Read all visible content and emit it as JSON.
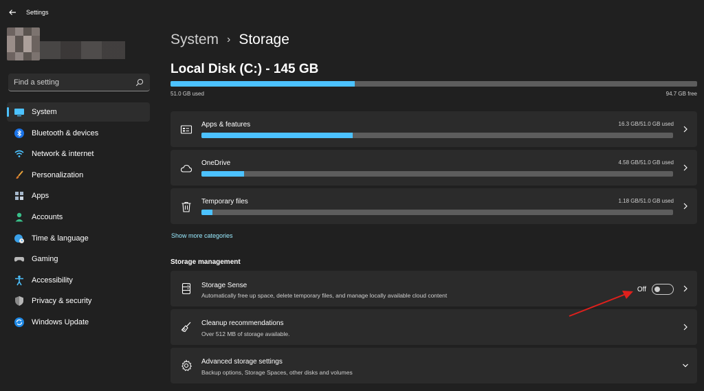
{
  "window": {
    "title": "Settings"
  },
  "search": {
    "placeholder": "Find a setting"
  },
  "sidebar": {
    "items": [
      {
        "label": "System",
        "icon": "monitor-icon",
        "selected": true
      },
      {
        "label": "Bluetooth & devices",
        "icon": "bluetooth-icon"
      },
      {
        "label": "Network & internet",
        "icon": "wifi-icon"
      },
      {
        "label": "Personalization",
        "icon": "brush-icon"
      },
      {
        "label": "Apps",
        "icon": "apps-icon"
      },
      {
        "label": "Accounts",
        "icon": "person-icon"
      },
      {
        "label": "Time & language",
        "icon": "globe-clock-icon"
      },
      {
        "label": "Gaming",
        "icon": "gamepad-icon"
      },
      {
        "label": "Accessibility",
        "icon": "accessibility-icon"
      },
      {
        "label": "Privacy & security",
        "icon": "shield-icon"
      },
      {
        "label": "Windows Update",
        "icon": "update-icon"
      }
    ]
  },
  "breadcrumb": {
    "parent": "System",
    "separator": "›",
    "current": "Storage"
  },
  "disk": {
    "title": "Local Disk (C:) - 145 GB",
    "used_label": "51.0 GB used",
    "free_label": "94.7 GB free",
    "used_fraction": 0.35
  },
  "categories": [
    {
      "label": "Apps & features",
      "size": "16.3 GB/51.0 GB used",
      "fraction": 0.32,
      "icon": "apps-features-icon"
    },
    {
      "label": "OneDrive",
      "size": "4.58 GB/51.0 GB used",
      "fraction": 0.09,
      "icon": "cloud-icon"
    },
    {
      "label": "Temporary files",
      "size": "1.18 GB/51.0 GB used",
      "fraction": 0.023,
      "icon": "trash-icon"
    }
  ],
  "show_more": "Show more categories",
  "storage_management": {
    "heading": "Storage management",
    "storage_sense": {
      "title": "Storage Sense",
      "description": "Automatically free up space, delete temporary files, and manage locally available cloud content",
      "toggle_label": "Off",
      "toggle_on": false
    },
    "cleanup": {
      "title": "Cleanup recommendations",
      "description": "Over 512 MB of storage available."
    },
    "advanced": {
      "title": "Advanced storage settings",
      "description": "Backup options, Storage Spaces, other disks and volumes"
    }
  },
  "colors": {
    "accent": "#4cc2ff",
    "background": "#202020",
    "card": "#2b2b2b",
    "annotation": "#e0201c"
  }
}
